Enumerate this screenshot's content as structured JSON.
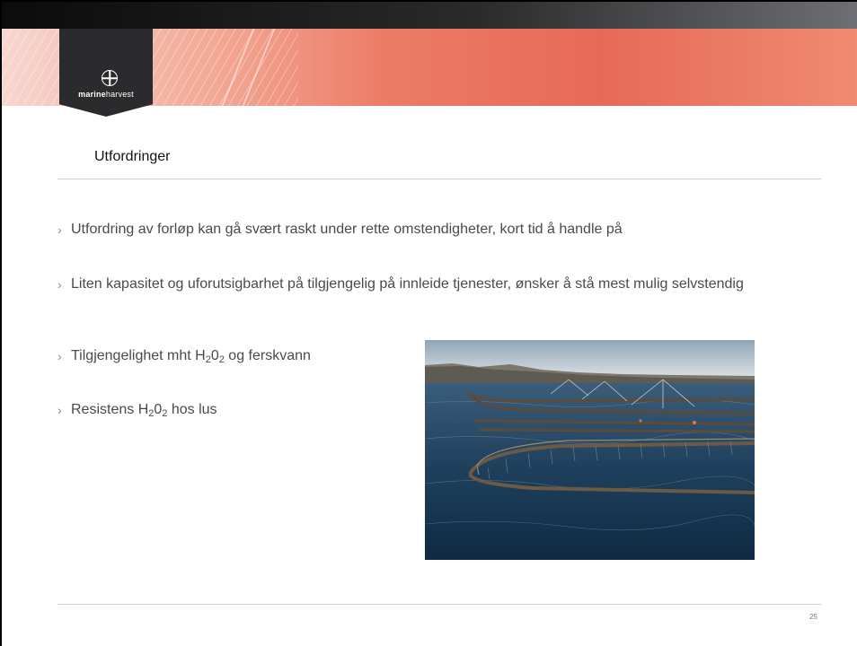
{
  "logo": {
    "text_bold": "marine",
    "text_regular": "harvest"
  },
  "section_title": "Utfordringer",
  "bullets": [
    {
      "text": "Utfordring av forløp kan gå svært raskt under rette omstendigheter, kort tid å handle på"
    },
    {
      "text": "Liten kapasitet og uforutsigbarhet på tilgjengelig på innleide tjenester, ønsker å stå mest mulig selvstendig"
    },
    {
      "pre": "Tilgjengelighet mht H",
      "s1": "2",
      "mid": "0",
      "s2": "2",
      "post": " og ferskvann"
    },
    {
      "pre": "Resistens H",
      "s1": "2",
      "mid": "0",
      "s2": "2",
      "post": " hos lus"
    }
  ],
  "bullet_marker": "›",
  "photo": {
    "subject": "fish-farm-pens-photo"
  },
  "page_number": "25",
  "colors": {
    "banner": "#e66a57",
    "topbar": "#1a1a1a",
    "logo_bg": "#2b2b2d",
    "text": "#4a4a4a"
  }
}
